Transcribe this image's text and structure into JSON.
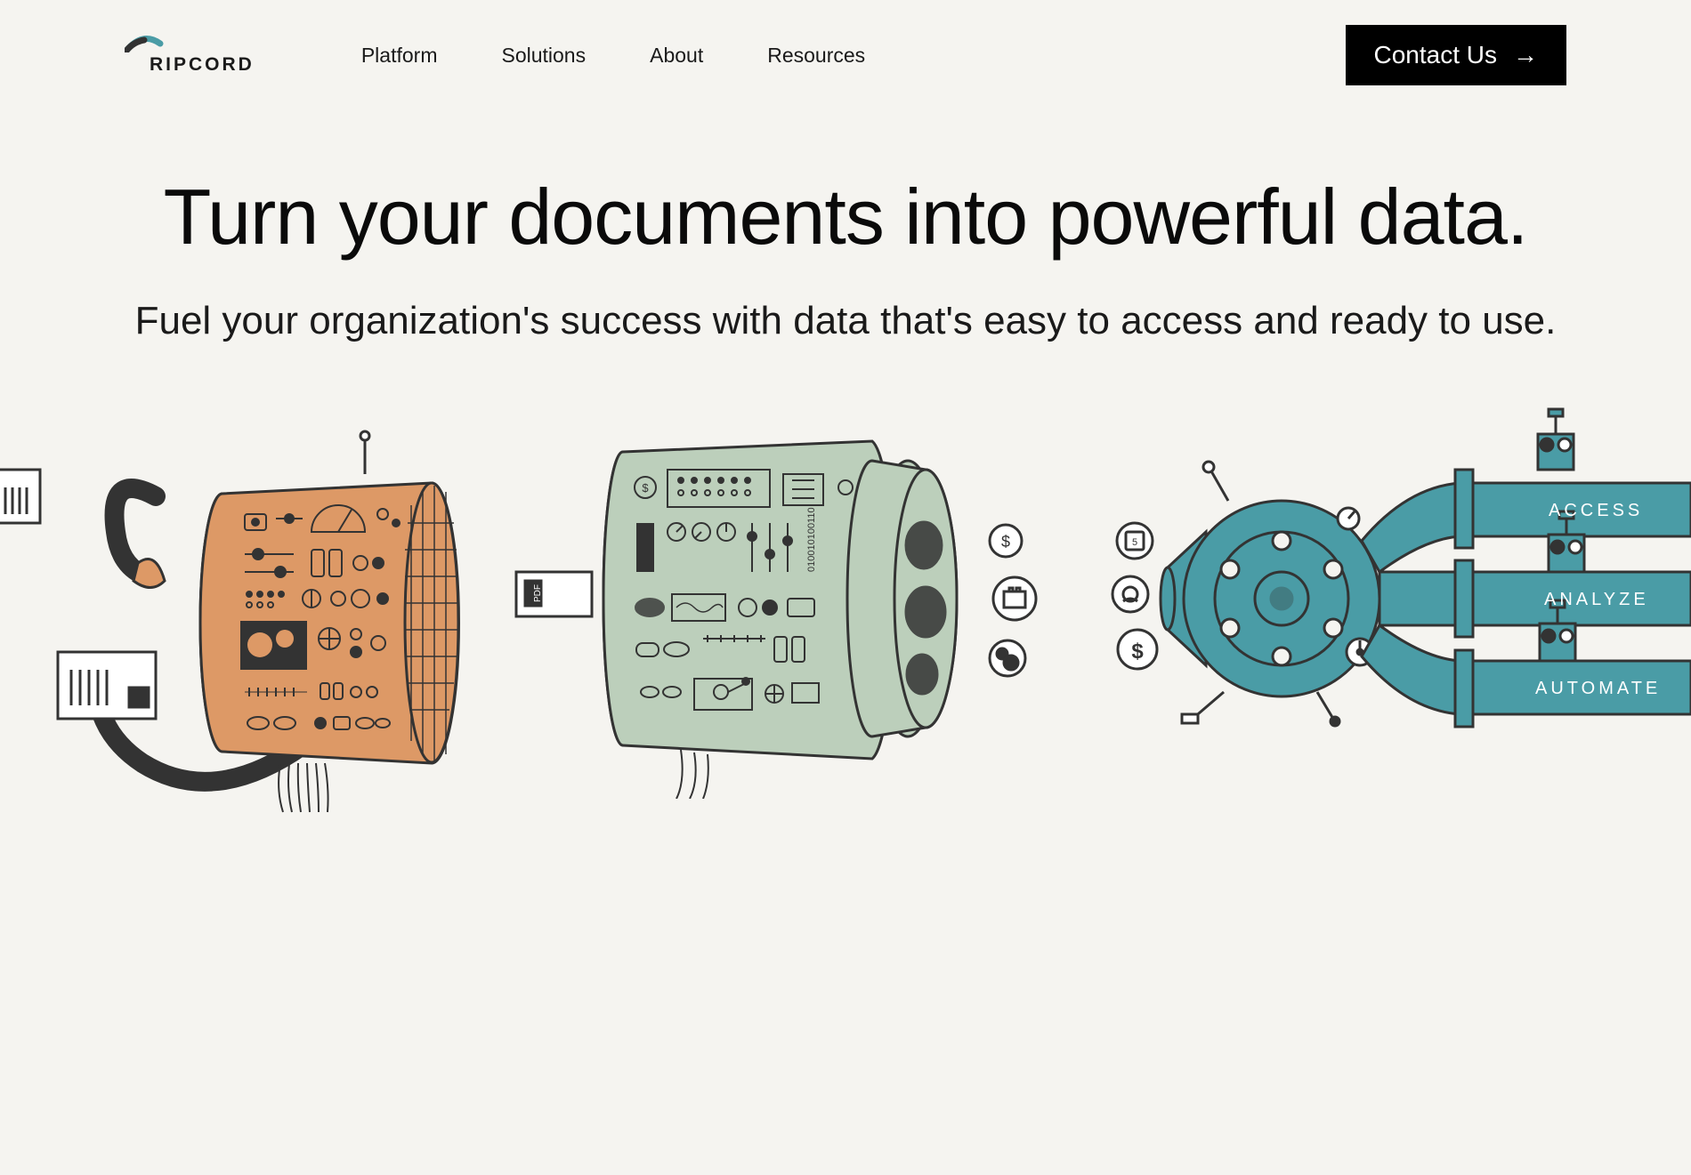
{
  "brand": {
    "name": "RIPCORD"
  },
  "nav": {
    "items": [
      {
        "label": "Platform"
      },
      {
        "label": "Solutions"
      },
      {
        "label": "About"
      },
      {
        "label": "Resources"
      }
    ]
  },
  "cta": {
    "label": "Contact Us"
  },
  "hero": {
    "title": "Turn your documents into powerful data.",
    "subtitle": "Fuel your organization's success with data that's easy to access and ready to use."
  },
  "pipes": {
    "labels": [
      "ACCESS",
      "ANALYZE",
      "AUTOMATE"
    ]
  },
  "colors": {
    "orange": "#dd9966",
    "sage": "#bccfbb",
    "teal": "#4a9ca6",
    "dark": "#333333",
    "bg": "#f5f4f0"
  }
}
